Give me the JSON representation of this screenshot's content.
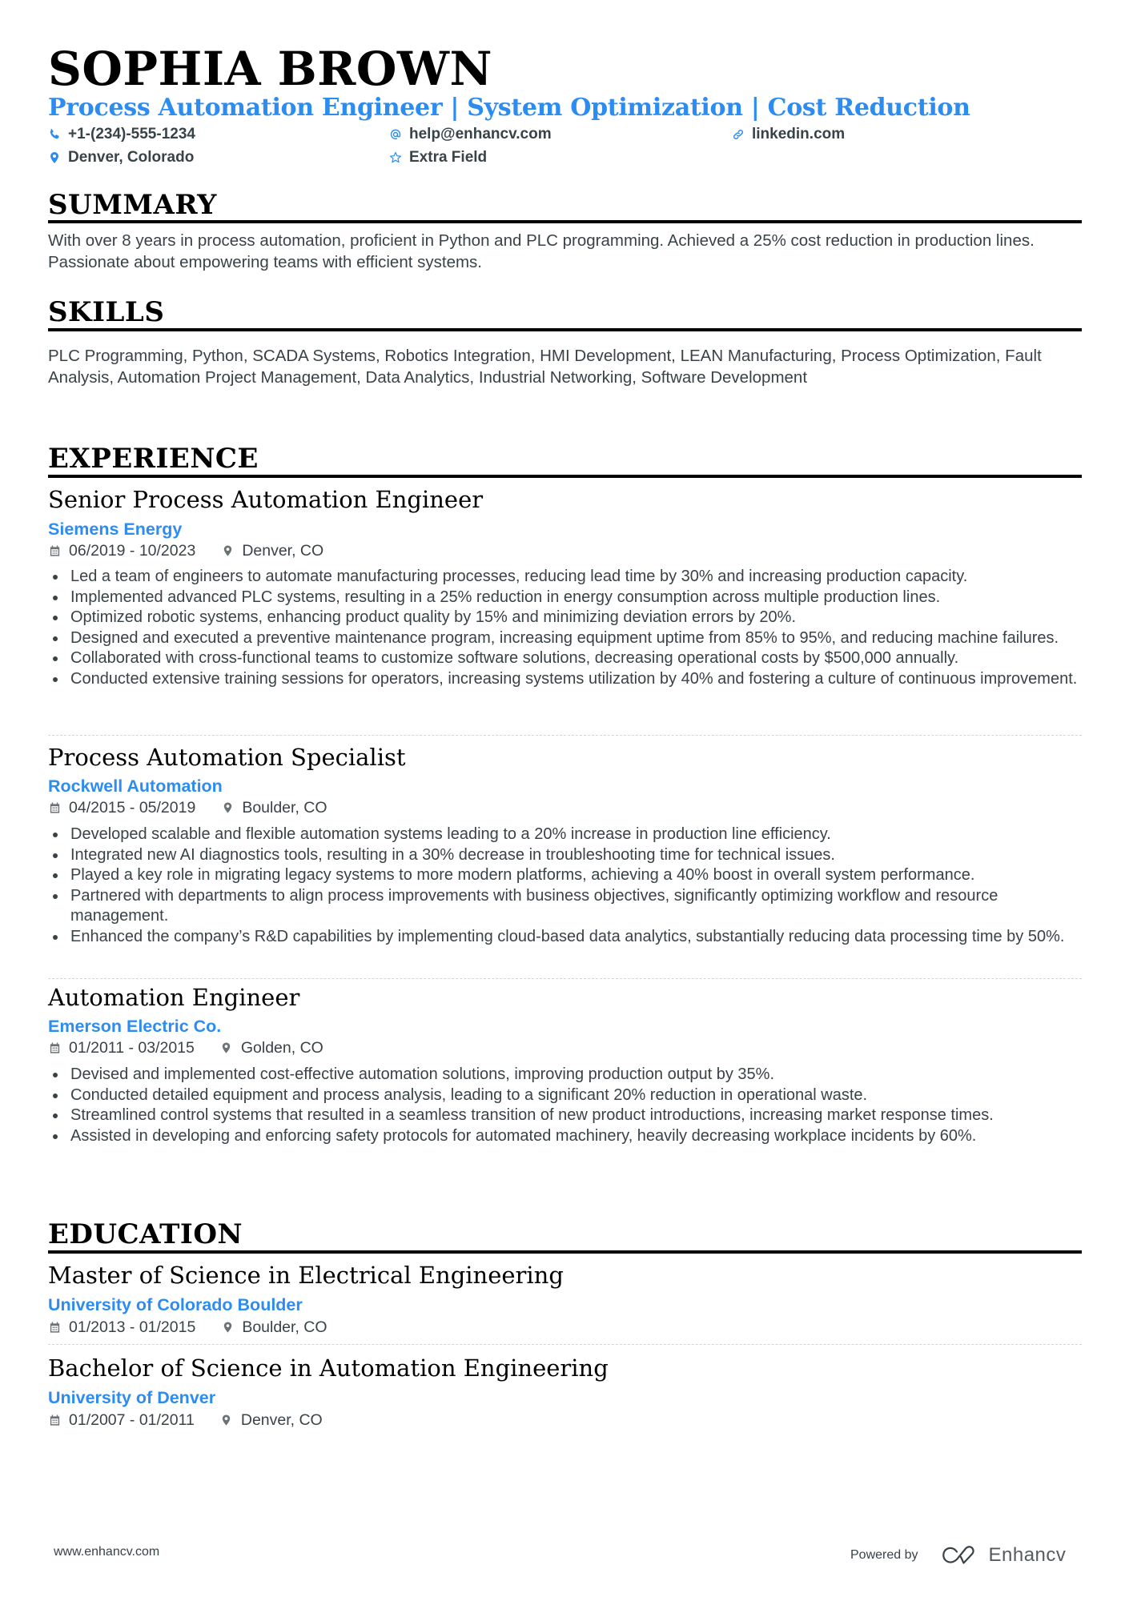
{
  "header": {
    "name": "SOPHIA BROWN",
    "headline": "Process Automation Engineer | System Optimization | Cost Reduction",
    "contacts": [
      {
        "icon": "phone-icon",
        "text": "+1-(234)-555-1234"
      },
      {
        "icon": "at-icon",
        "text": "help@enhancv.com"
      },
      {
        "icon": "link-icon",
        "text": "linkedin.com"
      },
      {
        "icon": "location-pin-icon",
        "text": "Denver, Colorado"
      },
      {
        "icon": "star-icon",
        "text": "Extra Field"
      }
    ]
  },
  "colors": {
    "accent": "#2d8cf0",
    "text": "#384347",
    "heading": "#000000"
  },
  "summary": {
    "title": "SUMMARY",
    "text": "With over 8 years in process automation, proficient in Python and PLC programming. Achieved a 25% cost reduction in production lines. Passionate about empowering teams with efficient systems."
  },
  "skills": {
    "title": "SKILLS",
    "text": "PLC Programming, Python, SCADA Systems, Robotics Integration, HMI Development, LEAN Manufacturing, Process Optimization, Fault Analysis, Automation Project Management, Data Analytics, Industrial Networking, Software Development"
  },
  "experience": {
    "title": "EXPERIENCE",
    "jobs": [
      {
        "title": "Senior Process Automation Engineer",
        "company": "Siemens Energy",
        "dates": "06/2019 - 10/2023",
        "location": "Denver, CO",
        "bullets": [
          "Led a team of engineers to automate manufacturing processes, reducing lead time by 30% and increasing production capacity.",
          "Implemented advanced PLC systems, resulting in a 25% reduction in energy consumption across multiple production lines.",
          "Optimized robotic systems, enhancing product quality by 15% and minimizing deviation errors by 20%.",
          "Designed and executed a preventive maintenance program, increasing equipment uptime from 85% to 95%, and reducing machine failures.",
          "Collaborated with cross-functional teams to customize software solutions, decreasing operational costs by $500,000 annually.",
          "Conducted extensive training sessions for operators, increasing systems utilization by 40% and fostering a culture of continuous improvement."
        ]
      },
      {
        "title": "Process Automation Specialist",
        "company": "Rockwell Automation",
        "dates": "04/2015 - 05/2019",
        "location": "Boulder, CO",
        "bullets": [
          "Developed scalable and flexible automation systems leading to a 20% increase in production line efficiency.",
          "Integrated new AI diagnostics tools, resulting in a 30% decrease in troubleshooting time for technical issues.",
          "Played a key role in migrating legacy systems to more modern platforms, achieving a 40% boost in overall system performance.",
          "Partnered with departments to align process improvements with business objectives, significantly optimizing workflow and resource management.",
          "Enhanced the company’s R&D capabilities by implementing cloud-based data analytics, substantially reducing data processing time by 50%."
        ]
      },
      {
        "title": "Automation Engineer",
        "company": "Emerson Electric Co.",
        "dates": "01/2011 - 03/2015",
        "location": "Golden, CO",
        "bullets": [
          "Devised and implemented cost-effective automation solutions, improving production output by 35%.",
          "Conducted detailed equipment and process analysis, leading to a significant 20% reduction in operational waste.",
          "Streamlined control systems that resulted in a seamless transition of new product introductions, increasing market response times.",
          "Assisted in developing and enforcing safety protocols for automated machinery, heavily decreasing workplace incidents by 60%."
        ]
      }
    ]
  },
  "education": {
    "title": "EDUCATION",
    "items": [
      {
        "degree": "Master of Science in Electrical Engineering",
        "school": "University of Colorado Boulder",
        "dates": "01/2013 - 01/2015",
        "location": "Boulder, CO"
      },
      {
        "degree": "Bachelor of Science in Automation Engineering",
        "school": "University of Denver",
        "dates": "01/2007 - 01/2011",
        "location": "Denver, CO"
      }
    ]
  },
  "footer": {
    "url": "www.enhancv.com",
    "powered_by": "Powered by",
    "brand": "Enhancv"
  }
}
